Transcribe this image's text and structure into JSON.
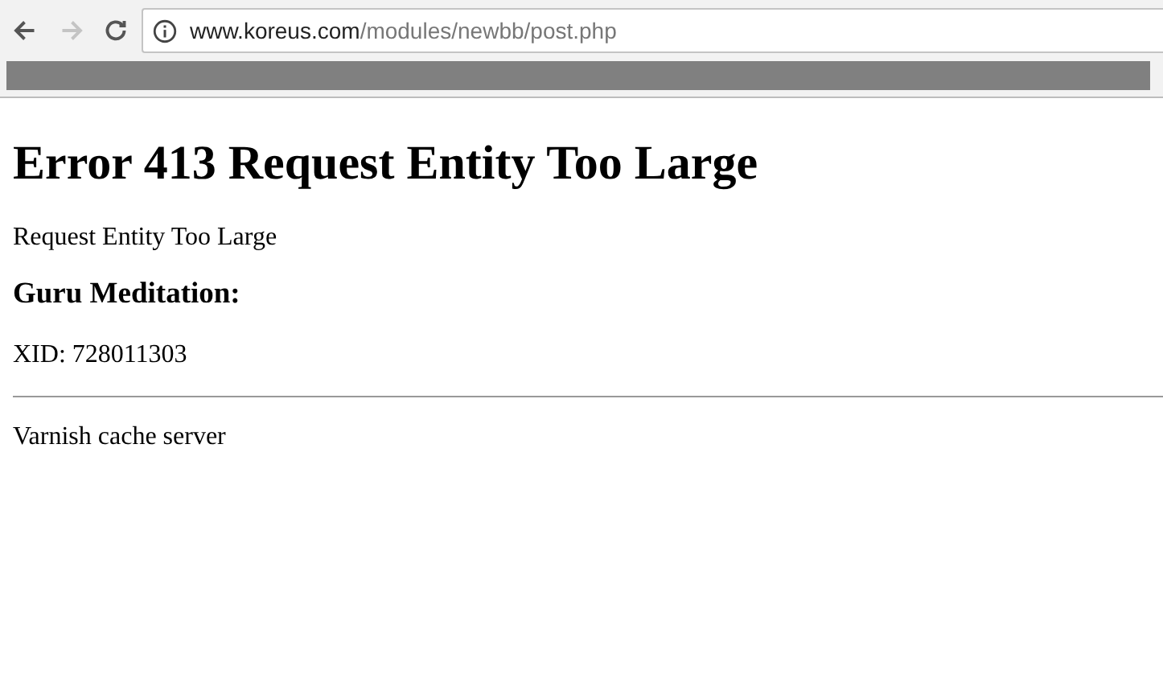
{
  "toolbar": {
    "nav": [
      {
        "kind": "back",
        "disabled": false
      },
      {
        "kind": "forward",
        "disabled": true
      },
      {
        "kind": "reload",
        "disabled": false
      }
    ],
    "address": {
      "host": "www.koreus.com",
      "path": "/modules/newbb/post.php"
    }
  },
  "page": {
    "title": "Error 413 Request Entity Too Large",
    "message": "Request Entity Too Large",
    "subtitle": "Guru Meditation:",
    "xid": "XID: 728011303",
    "footer": "Varnish cache server"
  }
}
